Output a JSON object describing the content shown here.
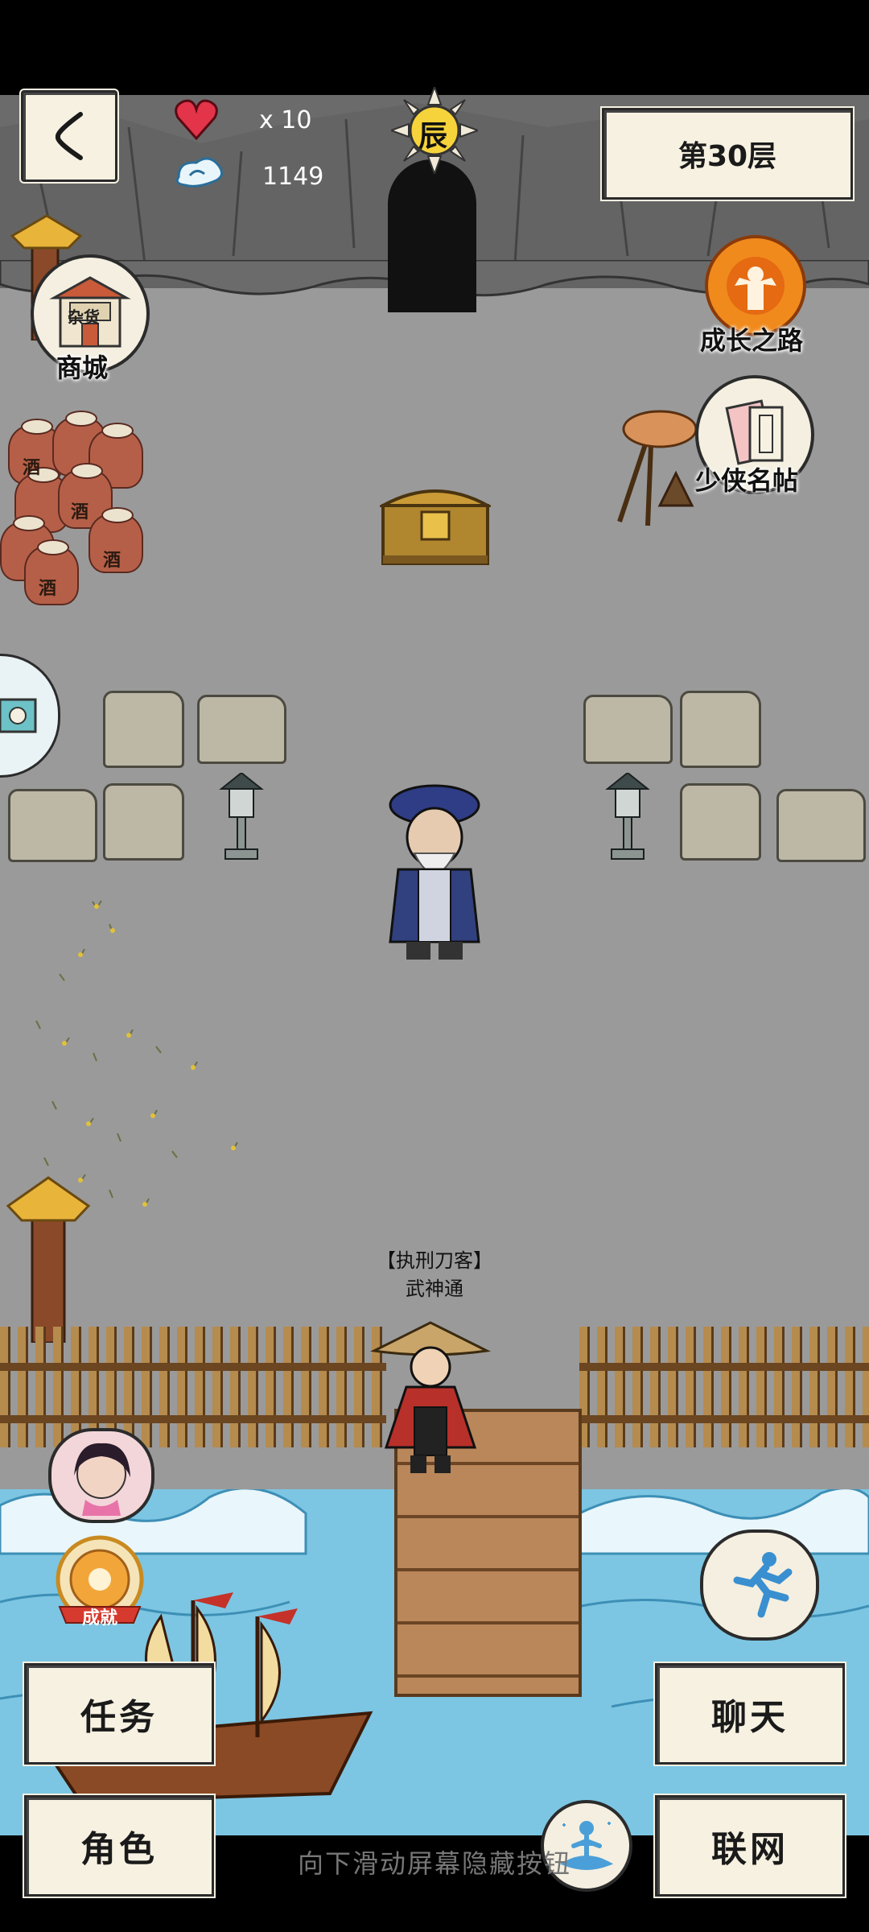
{
  "hud": {
    "lives": "x 10",
    "energy": "1149",
    "time_badge": "辰",
    "floor": "第30层"
  },
  "left_menu": {
    "shop_label": "商城",
    "shop_sign": "杂货",
    "achievement_badge": "成就"
  },
  "right_menu": {
    "growth_label": "成长之路",
    "roster_label": "少侠名帖"
  },
  "jars": {
    "char": "酒"
  },
  "npc_player": {
    "title": "【执刑刀客】",
    "name": "武神通"
  },
  "buttons": {
    "tasks": "任务",
    "character": "角色",
    "chat": "聊天",
    "network": "联网"
  },
  "hint": "向下滑动屏幕隐藏按钮",
  "colors": {
    "ground": "#9a9a9a",
    "cliff": "#6b6b6b",
    "water": "#7cc6e3",
    "paper": "#f6f1e1",
    "heart": "#e3344a",
    "growth_icon": "#f08a1c"
  },
  "icons": {
    "back": "back-chevron-icon",
    "heart": "heart-icon",
    "energy": "cloud-swirl-icon",
    "sun": "sun-badge-icon",
    "run": "running-man-icon",
    "meditate": "meditation-icon"
  }
}
